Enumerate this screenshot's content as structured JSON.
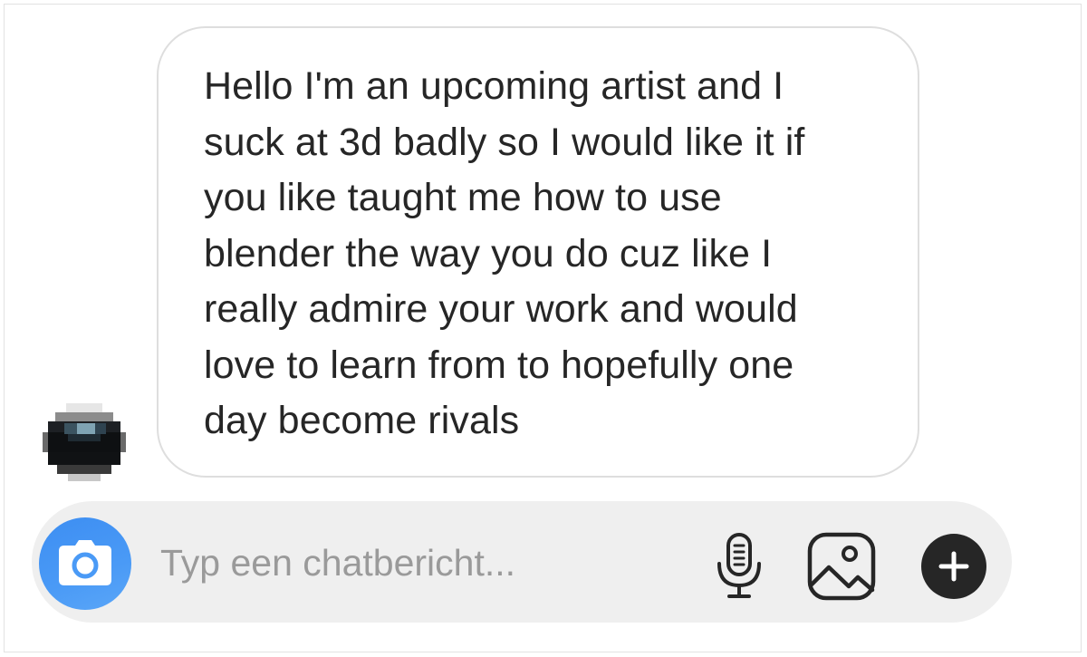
{
  "conversation": {
    "messages": [
      {
        "sender": "other",
        "text": "Hello I'm an upcoming artist and I\nsuck at 3d badly so I would like it if\nyou like taught me how to use\nblender the way you do cuz like I\nreally admire your work and would\nlove to learn from to hopefully one\nday become rivals"
      }
    ]
  },
  "composer": {
    "placeholder": "Typ een chatbericht...",
    "value": "",
    "icons": {
      "camera": "camera-icon",
      "microphone": "microphone-icon",
      "gallery": "image-gallery-icon",
      "more": "plus-icon"
    },
    "camera_color": "#3d8ef2"
  },
  "colors": {
    "bubble_border": "#dedede",
    "text": "#262626",
    "composer_background": "#efefef",
    "placeholder": "#9a9a9a"
  }
}
